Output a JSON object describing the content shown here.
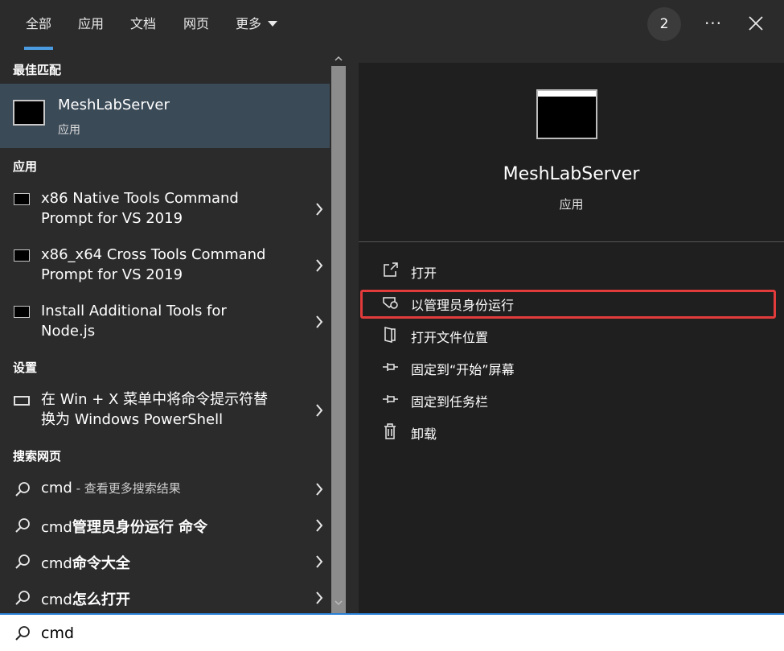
{
  "topbar": {
    "tabs": [
      {
        "label": "全部",
        "active": true
      },
      {
        "label": "应用"
      },
      {
        "label": "文档"
      },
      {
        "label": "网页"
      },
      {
        "label": "更多"
      }
    ],
    "badge": "2",
    "ellipsis": "···"
  },
  "left": {
    "best_match_title": "最佳匹配",
    "best_match": {
      "name": "MeshLabServer",
      "type": "应用"
    },
    "apps_title": "应用",
    "apps": [
      {
        "line1": "x86 Native Tools Command",
        "line2": "Prompt for VS 2019"
      },
      {
        "line1": "x86_x64 Cross Tools Command",
        "line2": "Prompt for VS 2019"
      },
      {
        "line1": "Install Additional Tools for",
        "line2": "Node.js"
      }
    ],
    "settings_title": "设置",
    "settings": [
      {
        "line1": "在 Win + X 菜单中将命令提示符替",
        "line2": "换为 Windows PowerShell"
      }
    ],
    "web_title": "搜索网页",
    "web": [
      {
        "main": "cmd",
        "sub": " - 查看更多搜索结果",
        "bold": ""
      },
      {
        "main": "cmd",
        "sub": "",
        "bold": "管理员身份运行 命令"
      },
      {
        "main": "cmd",
        "sub": "",
        "bold": "命令大全"
      },
      {
        "main": "cmd",
        "sub": "",
        "bold": "怎么打开"
      }
    ]
  },
  "right": {
    "title": "MeshLabServer",
    "subtitle": "应用",
    "actions": [
      {
        "label": "打开",
        "icon": "open-icon"
      },
      {
        "label": "以管理员身份运行",
        "icon": "shield-icon"
      },
      {
        "label": "打开文件位置",
        "icon": "folder-icon"
      },
      {
        "label": "固定到“开始”屏幕",
        "icon": "pin-icon"
      },
      {
        "label": "固定到任务栏",
        "icon": "pin-icon"
      },
      {
        "label": "卸载",
        "icon": "trash-icon"
      }
    ]
  },
  "search": {
    "query": "cmd"
  }
}
